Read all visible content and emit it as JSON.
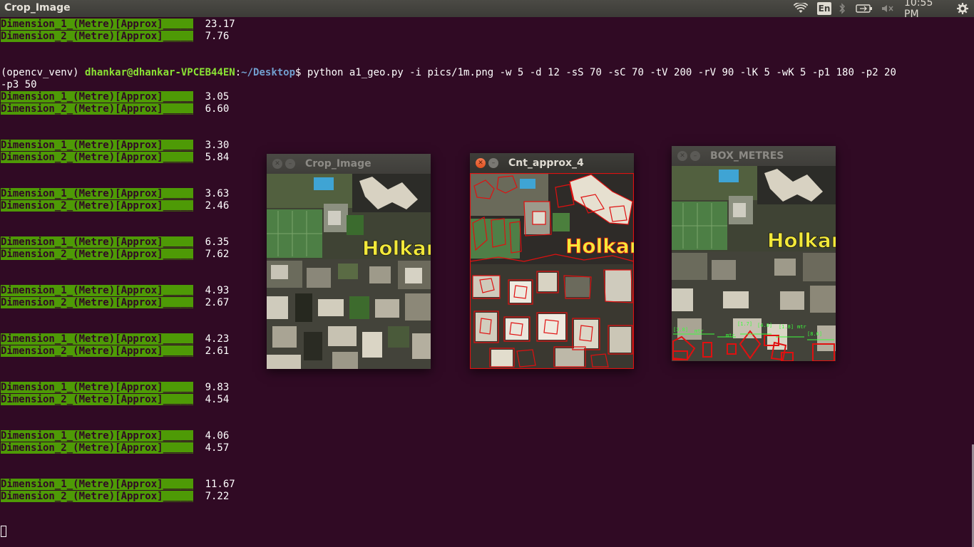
{
  "top_panel": {
    "app_title": "Crop_Image",
    "language": "En",
    "clock": "10:55 PM",
    "icons": [
      "wifi-icon",
      "bluetooth-icon",
      "battery-icon",
      "volume-mute-icon",
      "settings-gear-icon"
    ]
  },
  "terminal": {
    "lines": [
      {
        "label": "Dimension_1_(Metre)[Approx]_____",
        "value": "23.17"
      },
      {
        "label": "Dimension_2_(Metre)[Approx]_____",
        "value": "7.76"
      },
      {
        "label": "Dimension_1_(Metre)[Approx]_____",
        "value": "3.05"
      },
      {
        "label": "Dimension_2_(Metre)[Approx]_____",
        "value": "6.60"
      },
      {
        "label": "Dimension_1_(Metre)[Approx]_____",
        "value": "3.30"
      },
      {
        "label": "Dimension_2_(Metre)[Approx]_____",
        "value": "5.84"
      },
      {
        "label": "Dimension_1_(Metre)[Approx]_____",
        "value": "3.63"
      },
      {
        "label": "Dimension_2_(Metre)[Approx]_____",
        "value": "2.46"
      },
      {
        "label": "Dimension_1_(Metre)[Approx]_____",
        "value": "6.35"
      },
      {
        "label": "Dimension_2_(Metre)[Approx]_____",
        "value": "7.62"
      },
      {
        "label": "Dimension_1_(Metre)[Approx]_____",
        "value": "4.93"
      },
      {
        "label": "Dimension_2_(Metre)[Approx]_____",
        "value": "2.67"
      },
      {
        "label": "Dimension_1_(Metre)[Approx]_____",
        "value": "4.23"
      },
      {
        "label": "Dimension_2_(Metre)[Approx]_____",
        "value": "2.61"
      },
      {
        "label": "Dimension_1_(Metre)[Approx]_____",
        "value": "9.83"
      },
      {
        "label": "Dimension_2_(Metre)[Approx]_____",
        "value": "4.54"
      },
      {
        "label": "Dimension_1_(Metre)[Approx]_____",
        "value": "4.06"
      },
      {
        "label": "Dimension_2_(Metre)[Approx]_____",
        "value": "4.57"
      },
      {
        "label": "Dimension_1_(Metre)[Approx]_____",
        "value": "11.67"
      },
      {
        "label": "Dimension_2_(Metre)[Approx]_____",
        "value": "7.22"
      }
    ],
    "prompt": {
      "env": "(opencv_venv) ",
      "user": "dhankar@dhankar-VPCEB44EN",
      "sep": ":",
      "path": "~/Desktop",
      "dollar": "$ ",
      "command": "python a1_geo.py -i pics/1m.png -w 5 -d 12 -sS 70 -sC 70 -tV 200 -rV 90 -lK 5 -wK 5 -p1 180 -p2 20",
      "command_wrap": "-p3 50"
    }
  },
  "windows": {
    "crop": {
      "title": "Crop_Image",
      "overlay_text": "Holkar"
    },
    "cnt": {
      "title": "Cnt_approx_4",
      "overlay_text": "Holkar"
    },
    "box": {
      "title": "BOX_METRES",
      "overlay_text": "Holkar",
      "annotations": [
        "[1.7]",
        "[4.0]",
        "[1.8]",
        "mtr",
        "[8.6]",
        "mtr",
        "mtr",
        "[3.8]"
      ]
    }
  },
  "colors": {
    "terminal_bg": "#300a24",
    "label_bg": "#4e9a06",
    "user_green": "#8ae234",
    "path_blue": "#729fcf",
    "contour_red": "#e01010",
    "label_green": "#3cff3c"
  }
}
